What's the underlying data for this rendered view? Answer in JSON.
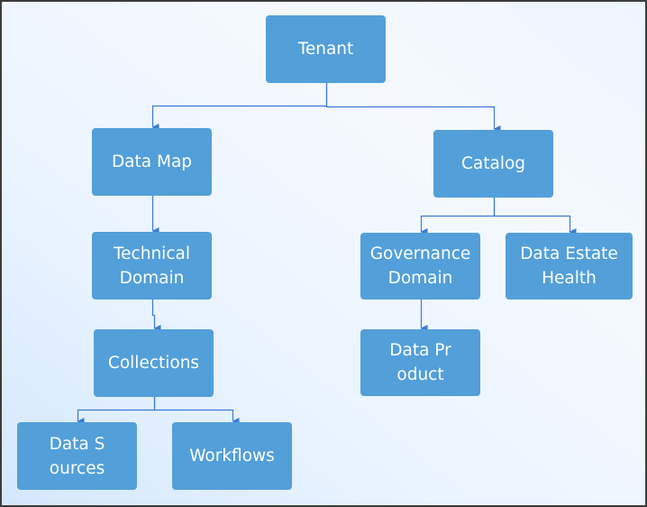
{
  "diagram": {
    "type": "org-chart",
    "colors": {
      "node": "#529fd9",
      "connector": "#3a7bd5",
      "text": "#ffffff"
    },
    "nodes": [
      {
        "id": "tenant",
        "label": "Tenant"
      },
      {
        "id": "data-map",
        "label": "Data Map"
      },
      {
        "id": "catalog",
        "label": "Catalog"
      },
      {
        "id": "technical-domain",
        "label": "Technical Domain"
      },
      {
        "id": "collections",
        "label": "Collections"
      },
      {
        "id": "data-sources",
        "label": "Data Sources"
      },
      {
        "id": "workflows",
        "label": "Workflows"
      },
      {
        "id": "governance-domain",
        "label": "Governance Domain"
      },
      {
        "id": "data-estate-health",
        "label": "Data Estate Health"
      },
      {
        "id": "data-product",
        "label": "Data Product"
      }
    ],
    "edges": [
      {
        "from": "tenant",
        "to": "data-map"
      },
      {
        "from": "tenant",
        "to": "catalog"
      },
      {
        "from": "data-map",
        "to": "technical-domain"
      },
      {
        "from": "technical-domain",
        "to": "collections"
      },
      {
        "from": "collections",
        "to": "data-sources"
      },
      {
        "from": "collections",
        "to": "workflows"
      },
      {
        "from": "catalog",
        "to": "governance-domain"
      },
      {
        "from": "catalog",
        "to": "data-estate-health"
      },
      {
        "from": "governance-domain",
        "to": "data-product"
      }
    ]
  }
}
